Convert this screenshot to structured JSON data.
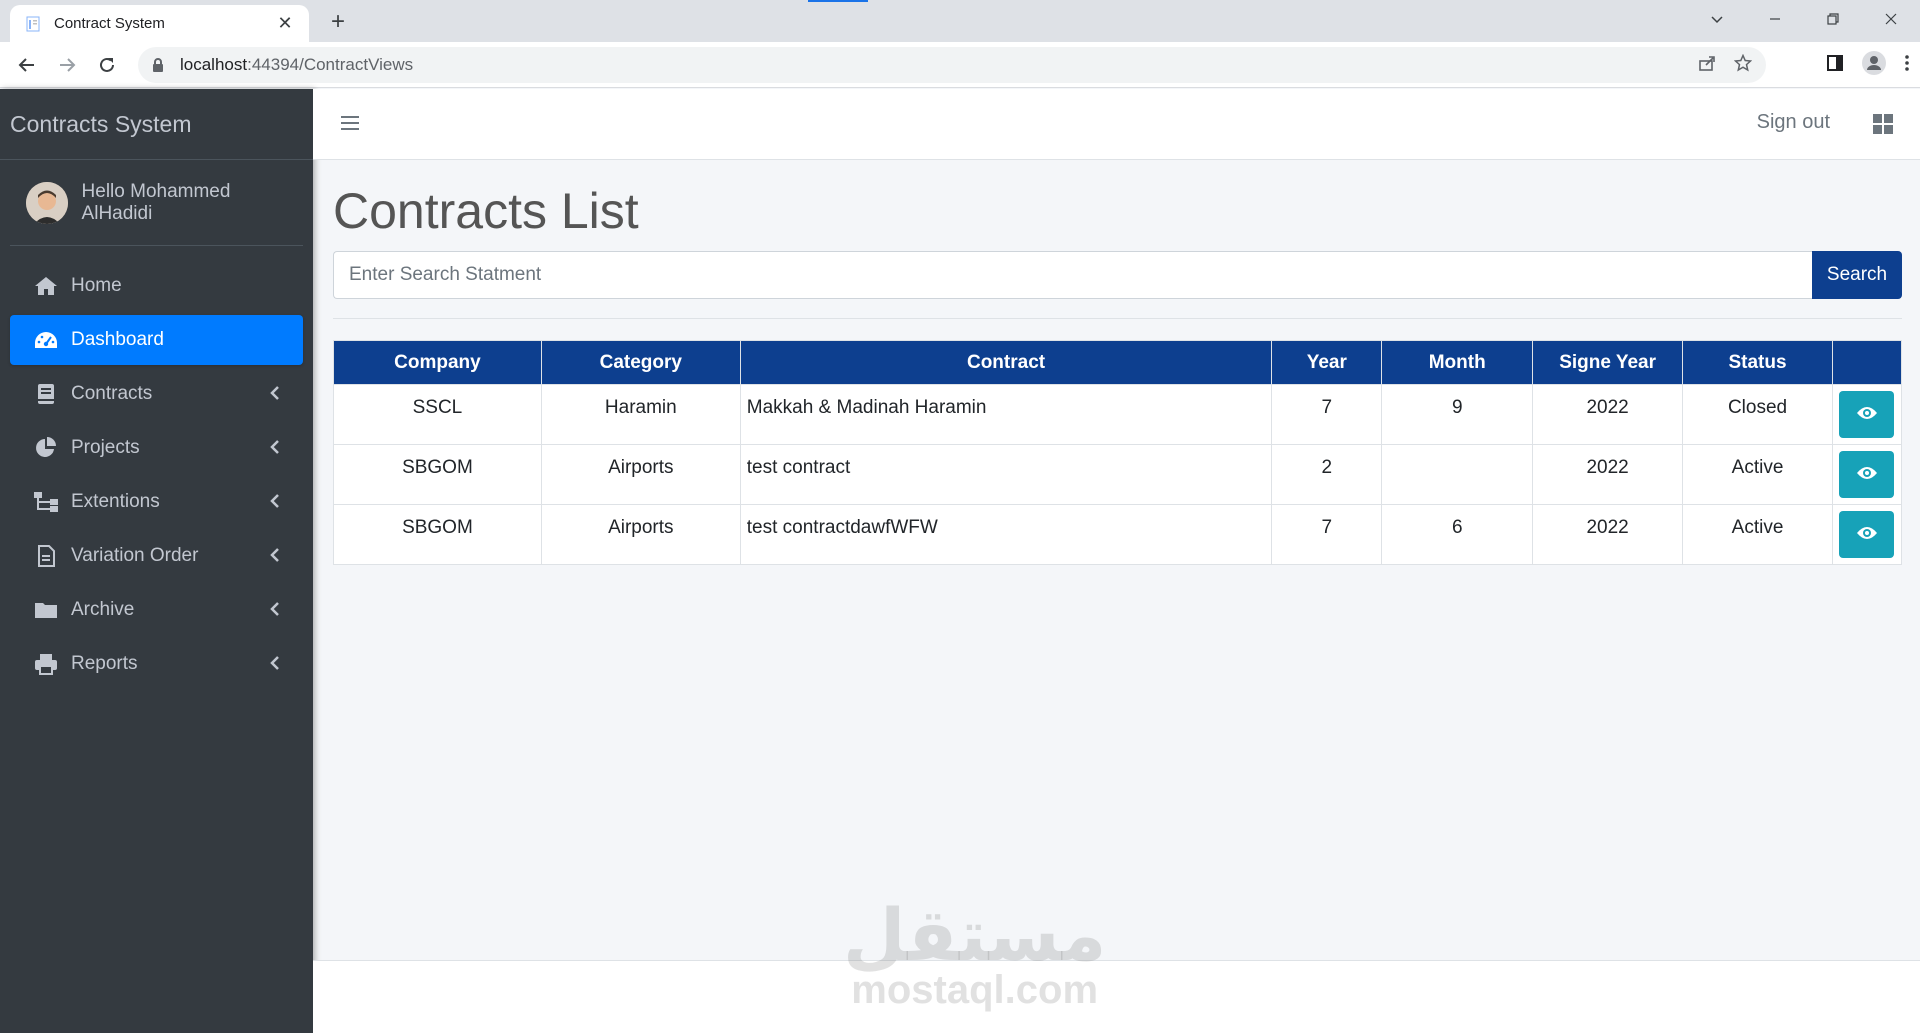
{
  "browser": {
    "tab_title": "Contract System",
    "url_host": "localhost",
    "url_rest": ":44394/ContractViews"
  },
  "sidebar": {
    "brand": "Contracts System",
    "user_greeting": "Hello Mohammed AlHadidi",
    "items": [
      {
        "label": "Home",
        "icon": "home-icon",
        "active": false,
        "has_caret": false
      },
      {
        "label": "Dashboard",
        "icon": "dashboard-icon",
        "active": true,
        "has_caret": false
      },
      {
        "label": "Contracts",
        "icon": "book-icon",
        "active": false,
        "has_caret": true
      },
      {
        "label": "Projects",
        "icon": "pie-chart-icon",
        "active": false,
        "has_caret": true
      },
      {
        "label": "Extentions",
        "icon": "sitemap-icon",
        "active": false,
        "has_caret": true
      },
      {
        "label": "Variation Order",
        "icon": "document-icon",
        "active": false,
        "has_caret": true
      },
      {
        "label": "Archive",
        "icon": "folder-icon",
        "active": false,
        "has_caret": true
      },
      {
        "label": "Reports",
        "icon": "printer-icon",
        "active": false,
        "has_caret": true
      }
    ]
  },
  "header": {
    "signout_label": "Sign out"
  },
  "main": {
    "title": "Contracts List",
    "search_placeholder": "Enter Search Statment",
    "search_button": "Search",
    "table": {
      "columns": [
        "Company",
        "Category",
        "Contract",
        "Year",
        "Month",
        "Signe Year",
        "Status",
        ""
      ],
      "rows": [
        {
          "company": "SSCL",
          "category": "Haramin",
          "contract": "Makkah & Madinah Haramin",
          "year": "7",
          "month": "9",
          "signe_year": "2022",
          "status": "Closed"
        },
        {
          "company": "SBGOM",
          "category": "Airports",
          "contract": "test contract",
          "year": "2",
          "month": "",
          "signe_year": "2022",
          "status": "Active"
        },
        {
          "company": "SBGOM",
          "category": "Airports",
          "contract": "test contractdawfWFW",
          "year": "7",
          "month": "6",
          "signe_year": "2022",
          "status": "Active"
        }
      ]
    }
  },
  "watermark": {
    "arabic": "مستقل",
    "latin": "mostaql.com"
  },
  "colors": {
    "sidebar_bg": "#343a40",
    "active_item": "#007bff",
    "table_header": "#0d3f8f",
    "view_button": "#17a2b8"
  }
}
